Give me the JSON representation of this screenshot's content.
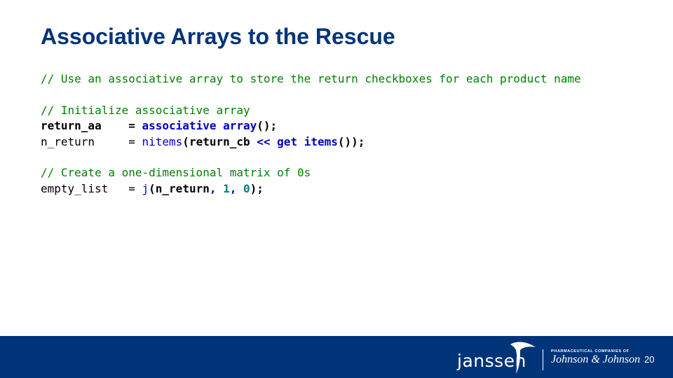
{
  "slide": {
    "title": "Associative Arrays to the Rescue",
    "page_number": "20"
  },
  "code": {
    "comment_1": "// Use an associative array to store the return checkboxes for each product name",
    "comment_2": "// Initialize associative array",
    "line_aa": {
      "var": "return_aa",
      "pad": "    ",
      "eq": "= ",
      "call": "associative array",
      "end": "();"
    },
    "line_nreturn": {
      "var": "n_return",
      "pad": "     ",
      "eq": "= ",
      "fn": "nitems",
      "open": "(",
      "arg": "return_cb",
      "op": " << ",
      "get": "get items",
      "end": "());"
    },
    "comment_3": "// Create a one-dimensional matrix of 0s",
    "line_empty": {
      "var": "empty_list",
      "pad": "   ",
      "eq": "= ",
      "fn": "j",
      "open": "(",
      "arg": "n_return",
      "sep1": ", ",
      "n1": "1",
      "sep2": ", ",
      "n2": "0",
      "end": ");"
    }
  },
  "footer": {
    "brand": "janssen",
    "parent_line": "PHARMACEUTICAL COMPANIES OF",
    "parent_name": "Johnson & Johnson"
  },
  "colors": {
    "title": "#003479",
    "footer": "#003479",
    "comment": "#008000",
    "keyword": "#0000c0",
    "number": "#008080"
  }
}
